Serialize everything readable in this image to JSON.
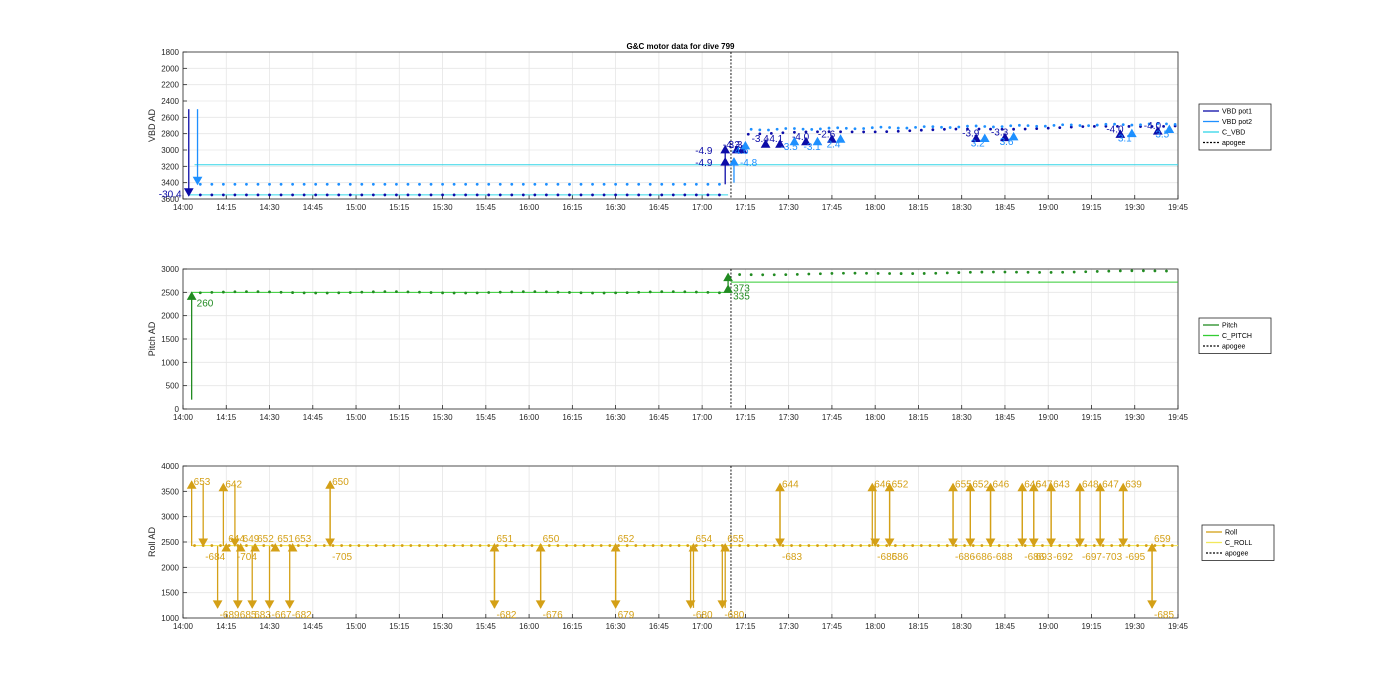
{
  "chart_data": [
    {
      "id": "vbd",
      "type": "line",
      "title": "G&C motor data for dive 799",
      "ylabel": "VBD AD",
      "ylim": [
        1800,
        3600
      ],
      "y_reversed": true,
      "yticks": [
        1800,
        2000,
        2200,
        2400,
        2600,
        2800,
        3000,
        3200,
        3400,
        3600
      ],
      "ytick_labels": [
        "1800",
        "2000",
        "2200",
        "2400",
        "2600",
        "2800",
        "3000",
        "3200",
        "3400",
        "3600"
      ],
      "xticks": [
        "14:00",
        "14:15",
        "14:30",
        "14:45",
        "15:00",
        "15:15",
        "15:30",
        "15:45",
        "16:00",
        "16:15",
        "16:30",
        "16:45",
        "17:00",
        "17:15",
        "17:30",
        "17:45",
        "18:00",
        "18:15",
        "18:30",
        "18:45",
        "19:00",
        "19:15",
        "19:30",
        "19:45"
      ],
      "grid": true,
      "legend_position": "right",
      "colors": {
        "pot1": "#0c0ca8",
        "pot2": "#1e90ff",
        "c": "#33d6e8",
        "apogee": "#000000"
      },
      "apogee_time": "17:10",
      "legend": [
        "VBD pot1",
        "VBD pot2",
        "C_VBD",
        "apogee"
      ],
      "c_level_early": 3550,
      "c_level_late": 3180,
      "pot1_start": 3550,
      "pot2_start": 3420,
      "pot1_late_start": 2800,
      "pot2_late_start": 2750,
      "pot1_late_end": 2700,
      "pot2_late_end": 2680,
      "events": [
        {
          "time": "14:02",
          "from": 2500,
          "to": 3560,
          "series": "pot1",
          "label": "-30.4"
        },
        {
          "time": "14:04",
          "from": 2500,
          "to": 3420,
          "series": "pot2",
          "label": ""
        },
        {
          "time": "17:08",
          "from": 3420,
          "to": 3100,
          "series": "pot1",
          "label": "-4.9"
        },
        {
          "time": "17:08",
          "from": 3100,
          "to": 2950,
          "series": "pot1",
          "label": "-4.9"
        },
        {
          "time": "17:10",
          "from": 3400,
          "to": 3100,
          "series": "pot2",
          "label": "-4.8"
        }
      ],
      "markers": [
        {
          "time": "17:12",
          "value": 2950,
          "series": "pot1",
          "label": "-4.3"
        },
        {
          "time": "17:14",
          "value": 2950,
          "series": "pot1",
          "label": "3.3"
        },
        {
          "time": "17:15",
          "value": 2900,
          "series": "pot2",
          "label": "-4.6"
        },
        {
          "time": "17:22",
          "value": 2880,
          "series": "pot1",
          "label": "-3.4"
        },
        {
          "time": "17:27",
          "value": 2880,
          "series": "pot1",
          "label": "-4.1"
        },
        {
          "time": "17:32",
          "value": 2850,
          "series": "pot2",
          "label": "-3.5"
        },
        {
          "time": "17:36",
          "value": 2850,
          "series": "pot1",
          "label": "-4.0"
        },
        {
          "time": "17:40",
          "value": 2850,
          "series": "pot2",
          "label": "-3.1"
        },
        {
          "time": "17:45",
          "value": 2820,
          "series": "pot1",
          "label": "-2.6"
        },
        {
          "time": "17:48",
          "value": 2820,
          "series": "pot2",
          "label": "2.4"
        },
        {
          "time": "18:35",
          "value": 2810,
          "series": "pot1",
          "label": "-3.9"
        },
        {
          "time": "18:38",
          "value": 2810,
          "series": "pot2",
          "label": "3.2"
        },
        {
          "time": "18:45",
          "value": 2800,
          "series": "pot1",
          "label": "-3.3"
        },
        {
          "time": "18:48",
          "value": 2790,
          "series": "pot2",
          "label": "3.6"
        },
        {
          "time": "19:25",
          "value": 2760,
          "series": "pot1",
          "label": "-4.0"
        },
        {
          "time": "19:29",
          "value": 2750,
          "series": "pot2",
          "label": "3.1"
        },
        {
          "time": "19:38",
          "value": 2720,
          "series": "pot1",
          "label": "-4.0"
        },
        {
          "time": "19:42",
          "value": 2700,
          "series": "pot2",
          "label": "3.5"
        }
      ]
    },
    {
      "id": "pitch",
      "type": "line",
      "title": "",
      "ylabel": "Pitch AD",
      "ylim": [
        0,
        3000
      ],
      "y_reversed": false,
      "yticks": [
        0,
        500,
        1000,
        1500,
        2000,
        2500,
        3000
      ],
      "ytick_labels": [
        "0",
        "500",
        "1000",
        "1500",
        "2000",
        "2500",
        "3000"
      ],
      "xticks": [
        "14:00",
        "14:15",
        "14:30",
        "14:45",
        "15:00",
        "15:15",
        "15:30",
        "15:45",
        "16:00",
        "16:15",
        "16:30",
        "16:45",
        "17:00",
        "17:15",
        "17:30",
        "17:45",
        "18:00",
        "18:15",
        "18:30",
        "18:45",
        "19:00",
        "19:15",
        "19:30",
        "19:45"
      ],
      "grid": true,
      "legend_position": "right",
      "colors": {
        "data": "#228b22",
        "c": "#33cc33",
        "apogee": "#000000"
      },
      "apogee_time": "17:10",
      "legend": [
        "Pitch",
        "C_PITCH",
        "apogee"
      ],
      "c_level_early": 2500,
      "c_level_late": 2720,
      "data_early": 2500,
      "data_late_start": 2880,
      "data_late_end": 2960,
      "events": [
        {
          "time": "14:03",
          "from": 200,
          "to": 2500,
          "label": "260"
        },
        {
          "time": "17:09",
          "from": 2500,
          "to": 2650,
          "label": "335"
        },
        {
          "time": "17:09",
          "from": 2650,
          "to": 2900,
          "label": "373"
        }
      ]
    },
    {
      "id": "roll",
      "type": "line",
      "title": "",
      "ylabel": "Roll AD",
      "ylim": [
        1000,
        4000
      ],
      "y_reversed": false,
      "yticks": [
        1000,
        1500,
        2000,
        2500,
        3000,
        3500,
        4000
      ],
      "ytick_labels": [
        "1000",
        "1500",
        "2000",
        "2500",
        "3000",
        "3500",
        "4000"
      ],
      "xticks": [
        "14:00",
        "14:15",
        "14:30",
        "14:45",
        "15:00",
        "15:15",
        "15:30",
        "15:45",
        "16:00",
        "16:15",
        "16:30",
        "16:45",
        "17:00",
        "17:15",
        "17:30",
        "17:45",
        "18:00",
        "18:15",
        "18:30",
        "18:45",
        "19:00",
        "19:15",
        "19:30",
        "19:45"
      ],
      "grid": true,
      "legend_position": "right",
      "colors": {
        "data": "#d4a017",
        "c": "#f2e85c",
        "apogee": "#000000"
      },
      "apogee_time": "17:10",
      "legend": [
        "Roll",
        "C_ROLL",
        "apogee"
      ],
      "c_level": 2430,
      "events": [
        {
          "time": "14:03",
          "from": 2420,
          "to": 3700,
          "label": "653"
        },
        {
          "time": "14:07",
          "from": 3650,
          "to": 2420,
          "label": "-684"
        },
        {
          "time": "14:12",
          "from": 2420,
          "to": 1200,
          "label": "-689"
        },
        {
          "time": "14:14",
          "from": 2420,
          "to": 3650,
          "label": "642"
        },
        {
          "time": "14:15",
          "from": 2420,
          "to": 2460,
          "label": "644"
        },
        {
          "time": "14:18",
          "from": 3650,
          "to": 2420,
          "label": "-704"
        },
        {
          "time": "14:19",
          "from": 2420,
          "to": 1200,
          "label": "685"
        },
        {
          "time": "14:20",
          "from": 2420,
          "to": 2460,
          "label": "649"
        },
        {
          "time": "14:24",
          "from": 2420,
          "to": 1200,
          "label": "683"
        },
        {
          "time": "14:25",
          "from": 2420,
          "to": 2460,
          "label": "652"
        },
        {
          "time": "14:30",
          "from": 2420,
          "to": 1200,
          "label": "-667"
        },
        {
          "time": "14:32",
          "from": 2420,
          "to": 2460,
          "label": "651"
        },
        {
          "time": "14:37",
          "from": 2420,
          "to": 1200,
          "label": "-682"
        },
        {
          "time": "14:38",
          "from": 2420,
          "to": 2460,
          "label": "653"
        },
        {
          "time": "14:51",
          "from": 2420,
          "to": 3700,
          "label": "650"
        },
        {
          "time": "14:51",
          "from": 3700,
          "to": 2420,
          "label": "-705"
        },
        {
          "time": "15:48",
          "from": 2420,
          "to": 1200,
          "label": "-682"
        },
        {
          "time": "15:48",
          "from": 1200,
          "to": 2460,
          "label": "651"
        },
        {
          "time": "16:04",
          "from": 2420,
          "to": 1200,
          "label": "-676"
        },
        {
          "time": "16:04",
          "from": 1200,
          "to": 2460,
          "label": "650"
        },
        {
          "time": "16:30",
          "from": 2420,
          "to": 1200,
          "label": "679"
        },
        {
          "time": "16:30",
          "from": 1200,
          "to": 2460,
          "label": "652"
        },
        {
          "time": "16:56",
          "from": 2420,
          "to": 1200,
          "label": "-680"
        },
        {
          "time": "16:57",
          "from": 1200,
          "to": 2460,
          "label": "654"
        },
        {
          "time": "17:07",
          "from": 2420,
          "to": 1200,
          "label": "-680"
        },
        {
          "time": "17:08",
          "from": 1200,
          "to": 2460,
          "label": "655"
        },
        {
          "time": "17:27",
          "from": 2420,
          "to": 3650,
          "label": "644"
        },
        {
          "time": "17:27",
          "from": 3650,
          "to": 2420,
          "label": "-683"
        },
        {
          "time": "17:59",
          "from": 2420,
          "to": 3650,
          "label": "646"
        },
        {
          "time": "18:00",
          "from": 3650,
          "to": 2420,
          "label": "-685"
        },
        {
          "time": "18:05",
          "from": 2420,
          "to": 3650,
          "label": "652"
        },
        {
          "time": "18:05",
          "from": 3650,
          "to": 2420,
          "label": "686"
        },
        {
          "time": "18:27",
          "from": 2420,
          "to": 3650,
          "label": "655"
        },
        {
          "time": "18:27",
          "from": 3650,
          "to": 2420,
          "label": "-686"
        },
        {
          "time": "18:33",
          "from": 2420,
          "to": 3650,
          "label": "652"
        },
        {
          "time": "18:33",
          "from": 3650,
          "to": 2420,
          "label": "-686"
        },
        {
          "time": "18:40",
          "from": 2420,
          "to": 3650,
          "label": "646"
        },
        {
          "time": "18:40",
          "from": 3650,
          "to": 2420,
          "label": "-688"
        },
        {
          "time": "18:51",
          "from": 2420,
          "to": 3650,
          "label": "646"
        },
        {
          "time": "18:51",
          "from": 3650,
          "to": 2420,
          "label": "-686"
        },
        {
          "time": "18:55",
          "from": 2420,
          "to": 3650,
          "label": "647"
        },
        {
          "time": "18:55",
          "from": 3650,
          "to": 2420,
          "label": "693"
        },
        {
          "time": "19:01",
          "from": 2420,
          "to": 3650,
          "label": "643"
        },
        {
          "time": "19:01",
          "from": 3650,
          "to": 2420,
          "label": "-692"
        },
        {
          "time": "19:11",
          "from": 2420,
          "to": 3650,
          "label": "648"
        },
        {
          "time": "19:11",
          "from": 3650,
          "to": 2420,
          "label": "-697"
        },
        {
          "time": "19:18",
          "from": 2420,
          "to": 3650,
          "label": "647"
        },
        {
          "time": "19:18",
          "from": 3650,
          "to": 2420,
          "label": "-703"
        },
        {
          "time": "19:26",
          "from": 2420,
          "to": 3650,
          "label": "639"
        },
        {
          "time": "19:26",
          "from": 3650,
          "to": 2420,
          "label": "-695"
        },
        {
          "time": "19:36",
          "from": 2420,
          "to": 1200,
          "label": "-685"
        },
        {
          "time": "19:36",
          "from": 1200,
          "to": 2460,
          "label": "659"
        }
      ]
    }
  ]
}
